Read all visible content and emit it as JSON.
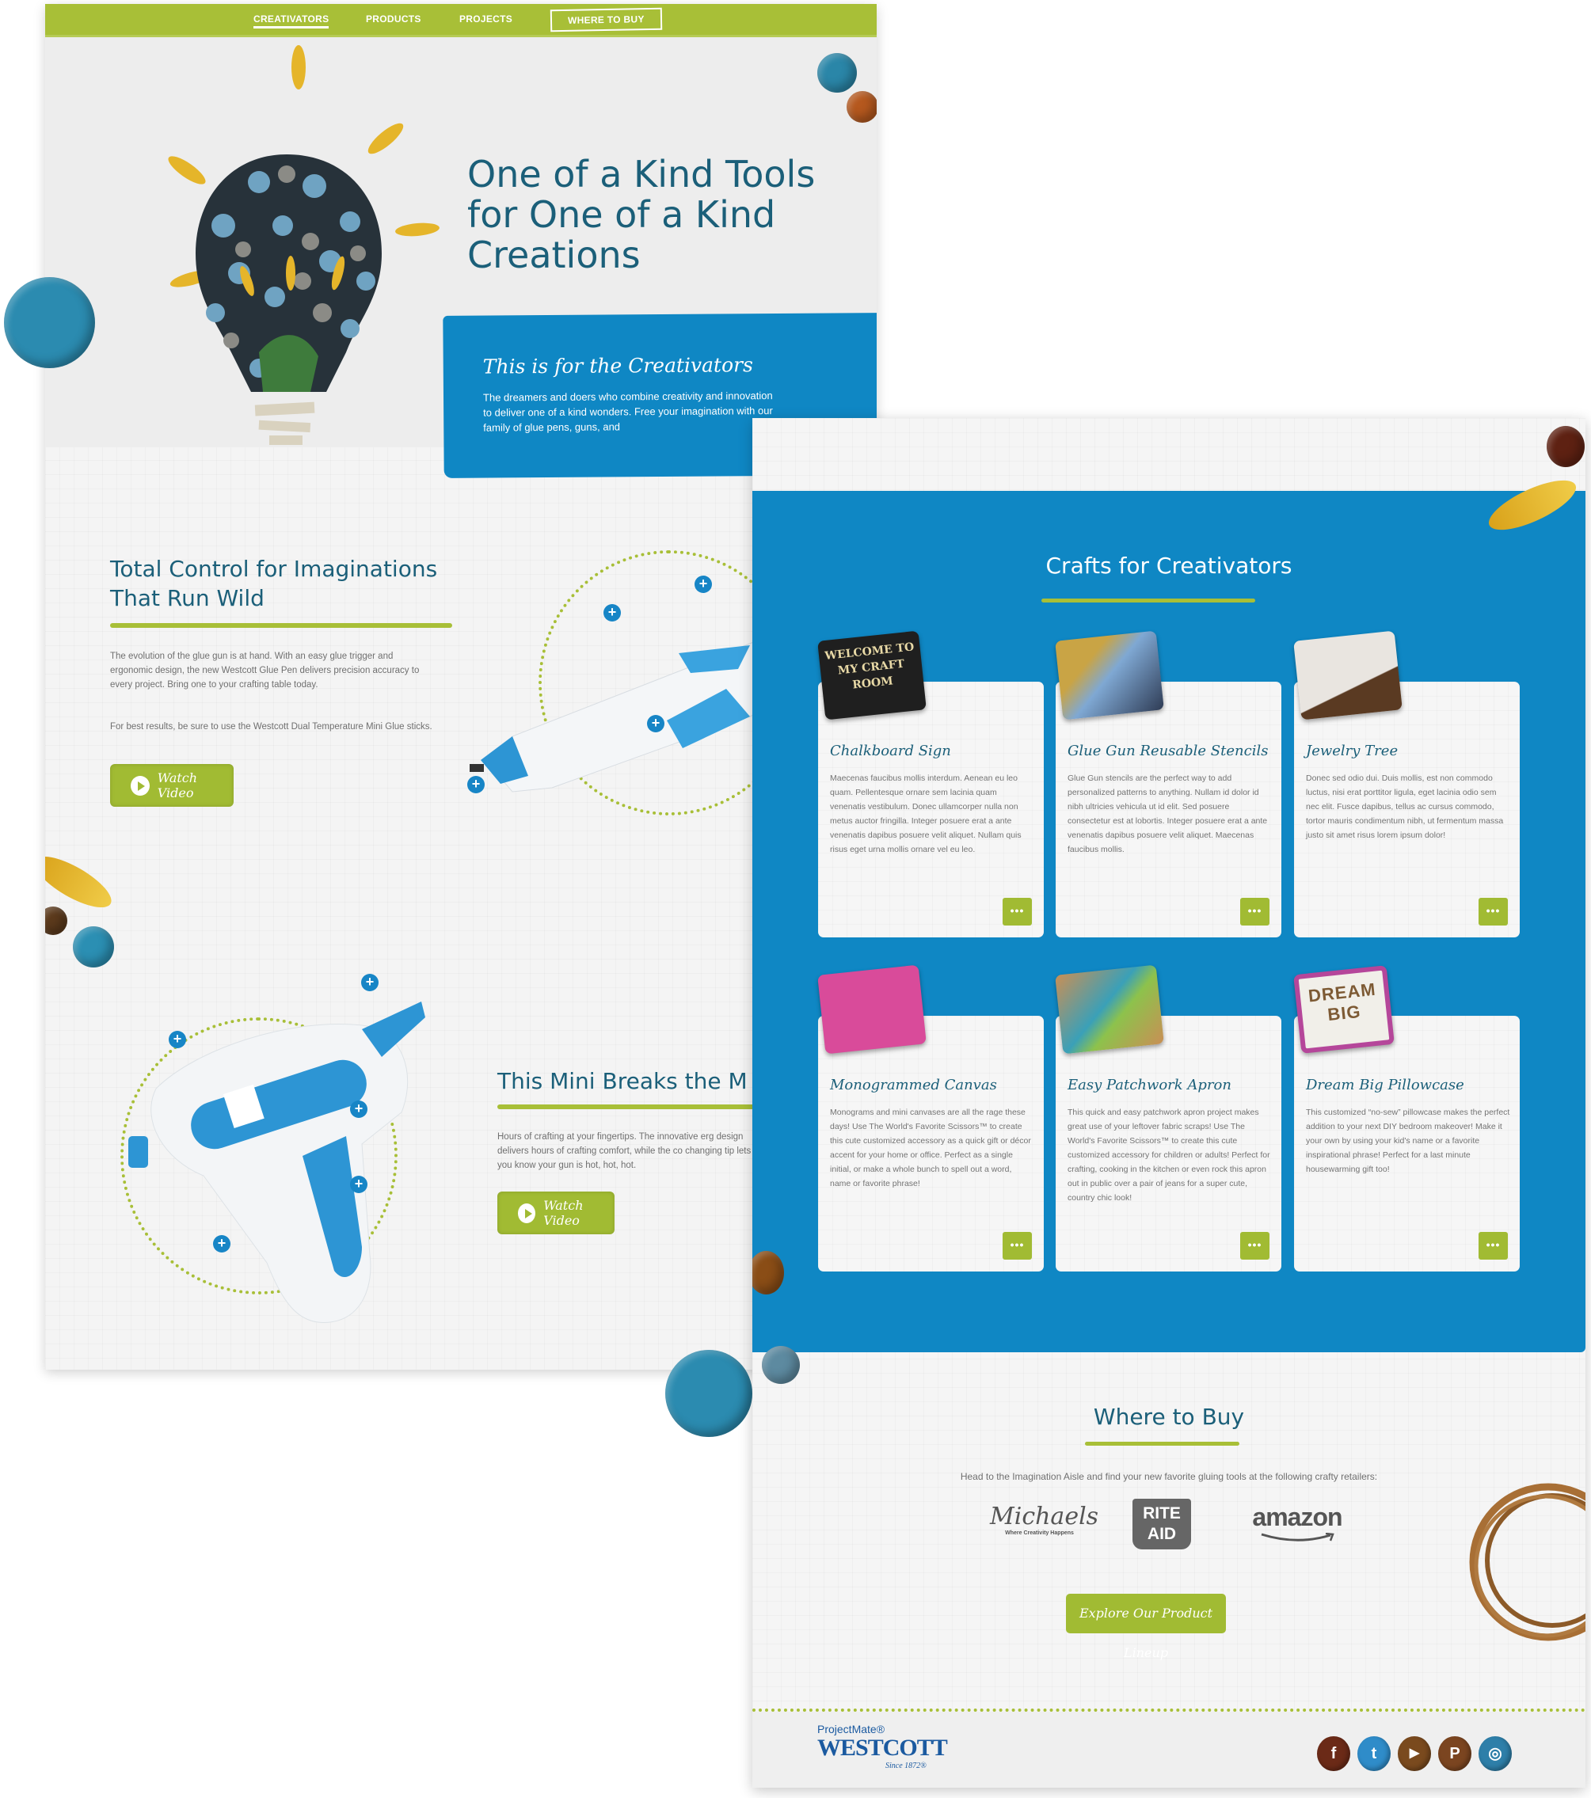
{
  "nav": {
    "items": [
      {
        "label": "CREATIVATORS",
        "active": true
      },
      {
        "label": "PRODUCTS",
        "active": false
      },
      {
        "label": "PROJECTS",
        "active": false
      },
      {
        "label": "WHERE TO BUY",
        "active": false
      }
    ]
  },
  "hero": {
    "title": "One of a Kind Tools for One of a Kind Creations",
    "banner_title": "This is for the Creativators",
    "banner_text": "The dreamers and doers who combine creativity and innovation to deliver one of a kind wonders. Free your imagination with our family of glue pens, guns, and"
  },
  "glue_pen": {
    "title": "Total Control for Imaginations That Run Wild",
    "paragraph_1": "The evolution of the glue gun is at hand. With an easy glue trigger and ergonomic design, the new Westcott Glue Pen delivers precision accuracy to every project. Bring one to your crafting table today.",
    "paragraph_2": "For best results, be sure to use the Westcott Dual Temperature Mini Glue sticks.",
    "button_label": "Watch Video"
  },
  "mini_gun": {
    "title": "This Mini Breaks the M",
    "paragraph": "Hours of crafting at your fingertips. The innovative erg design delivers hours of crafting comfort, while the co changing tip lets you know your gun is hot, hot, hot.",
    "button_label": "Watch Video"
  },
  "crafts": {
    "title": "Crafts for Creativators",
    "cards": [
      {
        "title": "Chalkboard Sign",
        "photo": "welcome-to-my-craft-room-sign",
        "photo_text": "WELCOME TO MY CRAFT ROOM",
        "text": "Maecenas faucibus mollis interdum. Aenean eu leo quam. Pellentesque ornare sem lacinia quam venenatis vestibulum. Donec ullamcorper nulla non metus auctor fringilla. Integer posuere erat a ante venenatis dapibus posuere velit aliquet. Nullam quis risus eget urna mollis ornare vel eu leo.",
        "more_label": "•••"
      },
      {
        "title": "Glue Gun Reusable Stencils",
        "photo": "leaf-stencils",
        "text": "Glue Gun stencils are the perfect way to add personalized patterns to anything. Nullam id dolor id nibh ultricies vehicula ut id elit. Sed posuere consectetur est at lobortis. Integer posuere erat a ante venenatis dapibus posuere velit aliquet. Maecenas faucibus mollis.",
        "more_label": "•••"
      },
      {
        "title": "Jewelry Tree",
        "photo": "branch-jewelry-tree",
        "text": "Donec sed odio dui. Duis mollis, est non commodo luctus, nisi erat porttitor ligula, eget lacinia odio sem nec elit. Fusce dapibus, tellus ac cursus commodo, tortor mauris condimentum nibh, ut fermentum massa justo sit amet risus lorem ipsum dolor!",
        "more_label": "•••"
      },
      {
        "title": "Monogrammed Canvas",
        "photo": "pink-canvas-with-scissors",
        "text": "Monograms and mini canvases are all the rage these days! Use The World's Favorite Scissors™ to create this cute customized accessory as a quick gift or décor accent for your home or office. Perfect as a single initial, or make a whole bunch to spell out a word, name or favorite phrase!",
        "more_label": "•••"
      },
      {
        "title": "Easy Patchwork Apron",
        "photo": "patchwork-apron",
        "text": "This quick and easy patchwork apron project makes great use of your leftover fabric scraps! Use The World's Favorite Scissors™ to create this cute customized accessory for children or adults! Perfect for crafting, cooking in the kitchen or even rock this apron out in public over a pair of jeans for a super cute, country chic look!",
        "more_label": "•••"
      },
      {
        "title": "Dream Big Pillowcase",
        "photo": "dream-big-pillowcase",
        "photo_text": "DREAM BIG",
        "text": "This customized “no-sew” pillowcase makes the perfect addition to your next DIY bedroom makeover! Make it your own by using your kid's name or a favorite inspirational phrase! Perfect for a last minute housewarming gift too!",
        "more_label": "•••"
      }
    ]
  },
  "where_to_buy": {
    "title": "Where to Buy",
    "subtitle": "Head to the Imagination Aisle and find your new favorite gluing tools at the following crafty retailers:",
    "retailers": [
      {
        "name": "Michaels",
        "tagline": "Where Creativity Happens"
      },
      {
        "name": "RITE AID",
        "line1": "RITE",
        "line2": "AID"
      },
      {
        "name": "amazon"
      }
    ],
    "button_label": "Explore Our Product Lineup"
  },
  "footer": {
    "brand_top": "ProjectMate®",
    "brand_main": "WESTCOTT",
    "brand_since": "Since 1872®",
    "social": [
      {
        "name": "facebook",
        "glyph": "f",
        "color": "#6b2a17"
      },
      {
        "name": "twitter",
        "glyph": "t",
        "color": "#2f8cc9"
      },
      {
        "name": "youtube",
        "glyph": "▶",
        "color": "#7a4a1e"
      },
      {
        "name": "pinterest",
        "glyph": "P",
        "color": "#7b4520"
      },
      {
        "name": "instagram",
        "glyph": "◎",
        "color": "#2e7fa9"
      }
    ]
  },
  "colors": {
    "green": "#a8bf37",
    "blue": "#0f87c4",
    "teal_text": "#1b5f79"
  }
}
